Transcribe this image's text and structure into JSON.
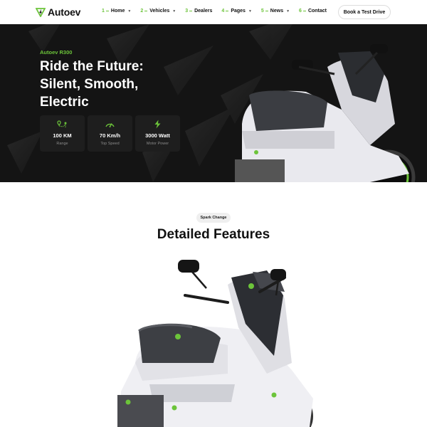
{
  "brand": {
    "name": "Autoev",
    "accent": "#6cc43a"
  },
  "nav": {
    "items": [
      {
        "num": "1",
        "label": "Home",
        "dropdown": true
      },
      {
        "num": "2",
        "label": "Vehicles",
        "dropdown": true
      },
      {
        "num": "3",
        "label": "Dealers",
        "dropdown": false
      },
      {
        "num": "4",
        "label": "Pages",
        "dropdown": true
      },
      {
        "num": "5",
        "label": "News",
        "dropdown": true
      },
      {
        "num": "6",
        "label": "Contact",
        "dropdown": false
      }
    ],
    "cta": "Book a Test Drive"
  },
  "hero": {
    "eyebrow": "Autoev R300",
    "title_lines": [
      "Ride the Future:",
      "Silent, Smooth,",
      "Electric"
    ],
    "stats": [
      {
        "icon": "route-pin-icon",
        "value": "100 KM",
        "label": "Range"
      },
      {
        "icon": "speedometer-icon",
        "value": "70 Km/h",
        "label": "Top Speed"
      },
      {
        "icon": "lightning-bolt-icon",
        "value": "3000 Watt",
        "label": "Motor Power"
      }
    ]
  },
  "features": {
    "tag": "Spark Change",
    "title": "Detailed Features"
  }
}
